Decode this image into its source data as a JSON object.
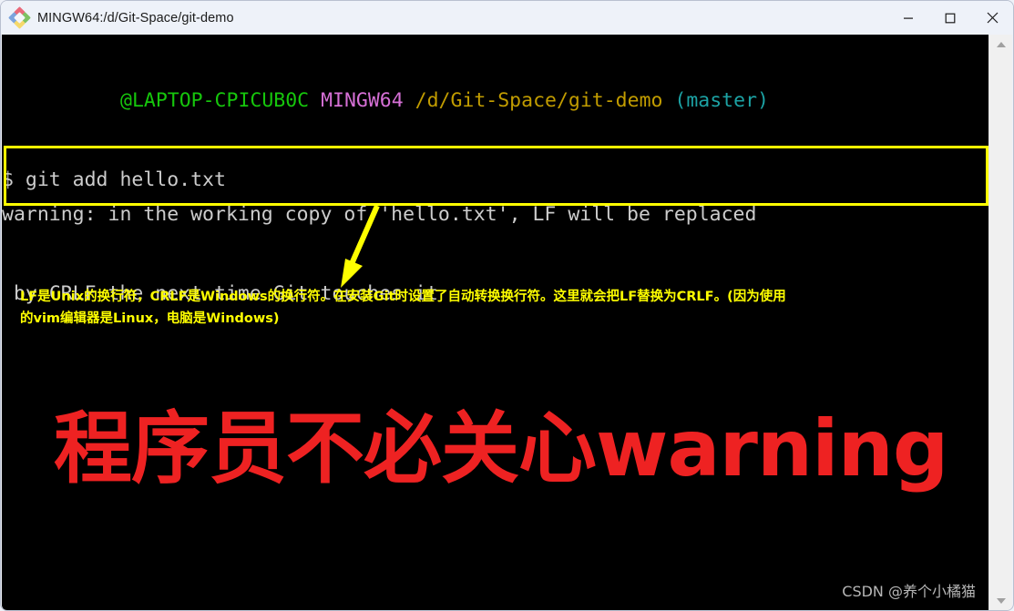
{
  "window": {
    "title": "MINGW64:/d/Git-Space/git-demo",
    "icon": "mingw64-diamond-icon",
    "controls": {
      "minimize_label": "Minimize",
      "maximize_label": "Maximize",
      "close_label": "Close"
    }
  },
  "terminal": {
    "prompt": {
      "user_host": "@LAPTOP-CPICUB0C",
      "shell": "MINGW64",
      "path": "/d/Git-Space/git-demo",
      "branch": "(master)",
      "colors": {
        "user_host": "#16c60c",
        "shell": "#d670d6",
        "path": "#c19c00",
        "branch": "#1ca2a4"
      }
    },
    "command_line": "$ git add hello.txt",
    "warning": {
      "line1": "warning: in the working copy of 'hello.txt', LF will be replaced",
      "line2": " by CRLF the next time Git touches it",
      "highlight_color": "#ffff00"
    },
    "background": "#000000",
    "text_color": "#cccccc"
  },
  "annotations": {
    "arrow": {
      "name": "yellow-down-arrow",
      "color": "#ffff00"
    },
    "note": {
      "line1": "LF是Unix的换行符，CRLF是Windows的换行符。在安装Git时设置了自动转换换行符。这里就会把LF替换为CRLF。(因为使用",
      "line2": "的vim编辑器是Linux，电脑是Windows)",
      "color": "#ffff00"
    },
    "headline": {
      "text": "程序员不必关心warning",
      "color": "#ee2222"
    },
    "watermark": {
      "text": "CSDN @养个小橘猫",
      "color": "#b6b6b6"
    }
  },
  "scrollbar": {
    "up_arrow": "scroll-up-arrow",
    "down_arrow": "scroll-down-arrow"
  }
}
